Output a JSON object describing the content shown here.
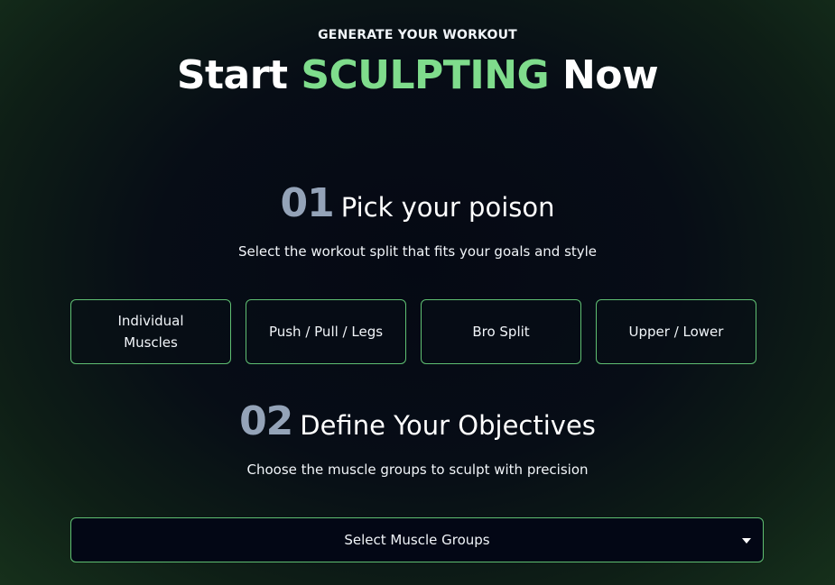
{
  "header": {
    "eyebrow": "GENERATE YOUR WORKOUT",
    "title_start": "Start",
    "title_accent": "SCULPTING",
    "title_end": "Now"
  },
  "step1": {
    "number": "01",
    "title": "Pick your poison",
    "description": "Select the workout split that fits your goals and style",
    "options": [
      {
        "label": "Individual Muscles"
      },
      {
        "label": "Push / Pull / Legs"
      },
      {
        "label": "Bro Split"
      },
      {
        "label": "Upper / Lower"
      }
    ]
  },
  "step2": {
    "number": "02",
    "title": "Define Your Objectives",
    "description": "Choose the muscle groups to sculpt with precision",
    "select_label": "Select Muscle Groups",
    "select_icon": "caret-down-icon"
  },
  "colors": {
    "accent": "#7fdc8c",
    "border": "#5fbf72",
    "step_number": "#94a3b8"
  }
}
